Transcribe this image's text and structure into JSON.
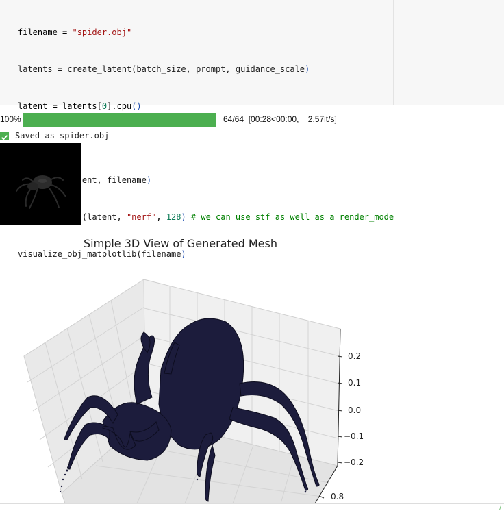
{
  "code": {
    "line1": {
      "a": "filename = ",
      "b": "\"spider.obj\""
    },
    "line2": {
      "a": "latents = create_latent(batch_size, prompt, guidance_scale",
      "b": ")"
    },
    "line3": {
      "a": "latent = latents[",
      "b": "0",
      "c": "].cpu",
      "d": "()"
    },
    "line5": {
      "a": "save_file(latent, filename",
      "b": ")"
    },
    "line6": {
      "a": "display_model(latent, ",
      "b": "\"nerf\"",
      "c": ", ",
      "d": "128",
      "e": ") ",
      "f": "# we can use stf as well as a render_mode"
    },
    "line7": {
      "a": "visualize_obj_matplotlib(filename",
      "b": ")"
    }
  },
  "progress": {
    "percent_label": "100%",
    "fraction": 1.0,
    "stats": "64/64  [00:28<00:00,    2.57it/s]"
  },
  "saved": {
    "text": "Saved as spider.obj"
  },
  "plot": {
    "title": "Simple 3D View of Generated Mesh",
    "z_ticks": [
      "0.2",
      "0.1",
      "0.0",
      "−0.1",
      "−0.2"
    ],
    "y_tick": "0.8",
    "mesh_color": "#1c1c3c",
    "pane_color": "#f2f2f2",
    "grid_color": "#d8d8d8"
  },
  "colors": {
    "progress_fill": "#4caf50",
    "string": "#a31515",
    "comment": "#008000"
  }
}
